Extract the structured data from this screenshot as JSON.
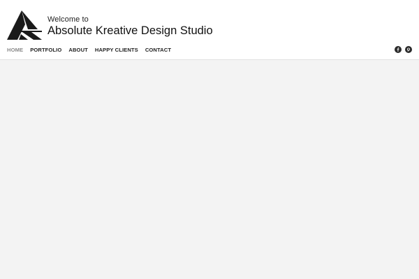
{
  "header": {
    "welcome_text": "Welcome to",
    "studio_name": "Absolute Kreative Design Studio"
  },
  "nav": {
    "items": [
      {
        "label": "HOME",
        "active": true
      },
      {
        "label": "PORTFOLIO",
        "active": false
      },
      {
        "label": "ABOUT",
        "active": false
      },
      {
        "label": "HAPPY CLIENTS",
        "active": false
      },
      {
        "label": "CONTACT",
        "active": false
      }
    ]
  },
  "social": {
    "icons": [
      "facebook-icon",
      "pinterest-icon"
    ]
  },
  "colors": {
    "header_bg": "#ffffff",
    "page_bg": "#f3f3f3",
    "nav_text": "#222222",
    "nav_active": "#8a8a8a",
    "logo": "#1a1a1a"
  }
}
